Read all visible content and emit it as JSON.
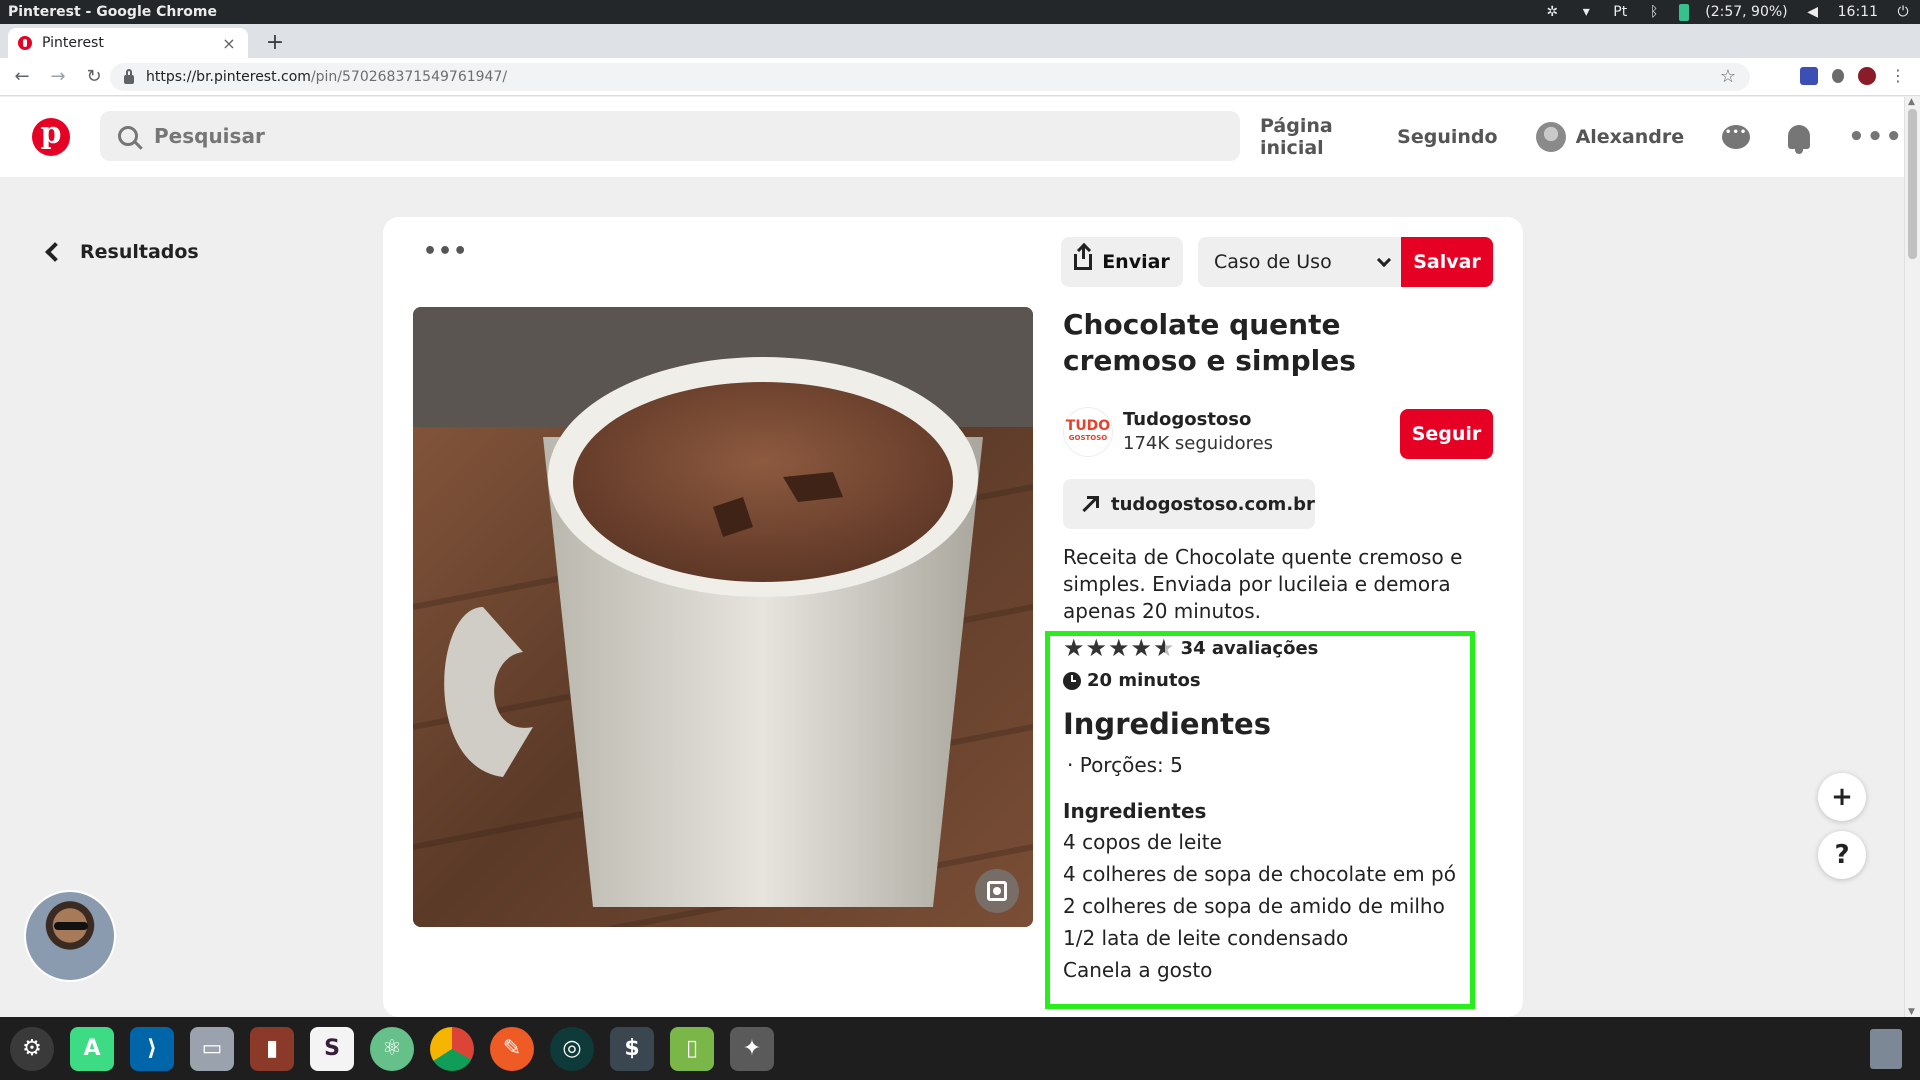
{
  "os": {
    "window_title": "Pinterest - Google Chrome",
    "battery_text": "(2:57, 90%)",
    "clock": "16:11",
    "keyboard_layout": "Pt"
  },
  "browser": {
    "tab_title": "Pinterest",
    "tab_close": "×",
    "new_tab": "+",
    "url_host": "https://br.pinterest.com",
    "url_path": "/pin/570268371549761947/"
  },
  "header": {
    "search_placeholder": "Pesquisar",
    "nav_home": "Página inicial",
    "nav_following": "Seguindo",
    "user_name": "Alexandre",
    "more": "•••"
  },
  "back_label": "Resultados",
  "pin": {
    "more": "•••",
    "send_label": "Enviar",
    "board_value": "Caso de Uso",
    "save_label": "Salvar",
    "title": "Chocolate quente cremoso e simples",
    "source": {
      "logo_text": "TUDO",
      "logo_sub": "GOSTOSO",
      "name": "Tudogostoso",
      "followers": "174K seguidores",
      "follow_label": "Seguir",
      "link": "tudogostoso.com.br"
    },
    "description": "Receita de Chocolate quente cremoso e simples. Enviada por lucileia e demora apenas 20 minutos.",
    "rating": {
      "value": 4.5,
      "max": 5,
      "reviews": "34 avaliações"
    },
    "time": "20 minutos",
    "ingredients_heading": "Ingredientes",
    "servings": "· Porções: 5",
    "ingredients_subheading": "Ingredientes",
    "ingredients": [
      "4 copos de leite",
      "4 colheres de sopa de chocolate em pó",
      "2 colheres de sopa de amido de milho",
      "1/2 lata de leite condensado",
      "Canela a gosto"
    ]
  },
  "float_buttons": {
    "add": "+",
    "help": "?"
  },
  "colors": {
    "brand": "#e60023",
    "highlight": "#28ee1c",
    "page_bg": "#efefef"
  }
}
